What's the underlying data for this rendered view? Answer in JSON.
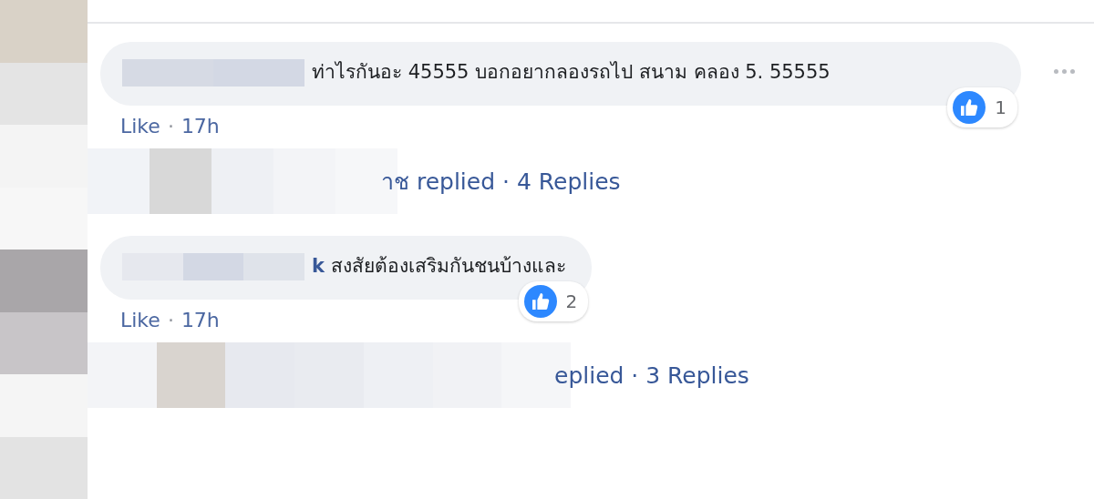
{
  "comments": [
    {
      "text": "ท่าไรกันอะ 45555 บอกอยากลองรถไป สนาม คลอง 5. 55555",
      "options_visible": true,
      "reaction_count": "1",
      "like": "Like",
      "separator": "·",
      "time": "17h",
      "replies": "าช replied · 4 Replies"
    },
    {
      "author": "k",
      "text": "สงสัยต้องเสริมกันชนบ้างและ",
      "options_visible": false,
      "reaction_count": "2",
      "like": "Like",
      "separator": "·",
      "time": "17h",
      "replies": "eplied · 3 Replies"
    }
  ]
}
